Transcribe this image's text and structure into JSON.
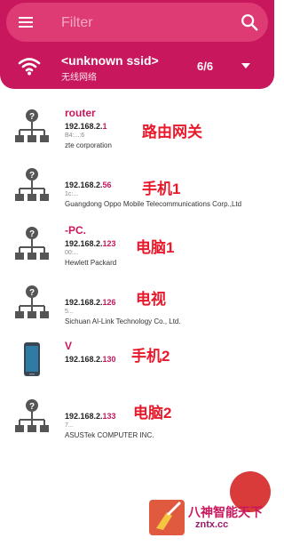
{
  "search": {
    "placeholder": "Filter"
  },
  "network": {
    "ssid": "<unknown ssid>",
    "subtitle": "无线网络",
    "count": "6/6"
  },
  "devices": [
    {
      "name": "router",
      "ip_prefix": "192.168.2.",
      "ip_tail": "1",
      "mac": "B4:...:6",
      "vendor": "zte corporation",
      "icon": "network-icon",
      "note": "路由网关"
    },
    {
      "name": "",
      "ip_prefix": "192.168.2.",
      "ip_tail": "56",
      "mac": "1c:...",
      "vendor": "Guangdong Oppo Mobile Telecommunications Corp.,Ltd",
      "icon": "network-icon",
      "note": "手机1"
    },
    {
      "name": "-PC.",
      "ip_prefix": "192.168.2.",
      "ip_tail": "123",
      "mac": "00:...",
      "vendor": "Hewlett Packard",
      "icon": "network-icon",
      "note": "电脑1"
    },
    {
      "name": "",
      "ip_prefix": "192.168.2.",
      "ip_tail": "126",
      "mac": "5...",
      "vendor": "Sichuan AI-Link Technology Co., Ltd.",
      "icon": "network-icon",
      "note": "电视"
    },
    {
      "name": "V",
      "ip_prefix": "192.168.2.",
      "ip_tail": "130",
      "mac": "",
      "vendor": "",
      "icon": "phone-icon",
      "note": "手机2"
    },
    {
      "name": "",
      "ip_prefix": "192.168.2.",
      "ip_tail": "133",
      "mac": "7...",
      "vendor": "ASUSTek COMPUTER INC.",
      "icon": "network-icon",
      "note": "电脑2"
    }
  ],
  "watermark": {
    "line1": "八神智能天下",
    "line2": "zntx.cc"
  },
  "colors": {
    "primary": "#c8175d",
    "annotation": "#e8192b",
    "fab": "#d93a3a"
  }
}
